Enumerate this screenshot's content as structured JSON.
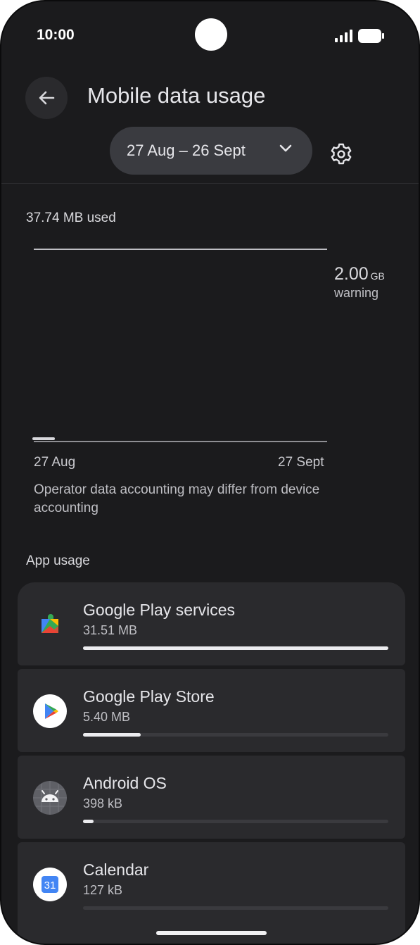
{
  "status_bar": {
    "time": "10:00"
  },
  "header": {
    "title": "Mobile data usage"
  },
  "date_range": {
    "label": "27 Aug – 26 Sept"
  },
  "usage": {
    "used_label": "37.74 MB used",
    "warning_value": "2.00",
    "warning_unit": "GB",
    "warning_label": "warning",
    "start_label": "27 Aug",
    "end_label": "27 Sept",
    "note": "Operator data accounting may differ from device accounting"
  },
  "app_usage": {
    "title": "App usage",
    "apps": [
      {
        "name": "Google Play services",
        "size": "31.51 MB",
        "fraction": 1.0,
        "icon": "google-play-services-icon"
      },
      {
        "name": "Google Play Store",
        "size": "5.40 MB",
        "fraction": 0.19,
        "icon": "google-play-store-icon"
      },
      {
        "name": "Android OS",
        "size": "398 kB",
        "fraction": 0.035,
        "icon": "android-os-icon"
      },
      {
        "name": "Calendar",
        "size": "127 kB",
        "fraction": 0.0,
        "icon": "calendar-icon",
        "icon_text": "31"
      }
    ]
  },
  "colors": {
    "background": "#1b1b1d",
    "card": "#2a2a2d",
    "pill": "#3a3b40",
    "bar_fill": "#ececef",
    "bar_track": "#3a3a3e"
  }
}
